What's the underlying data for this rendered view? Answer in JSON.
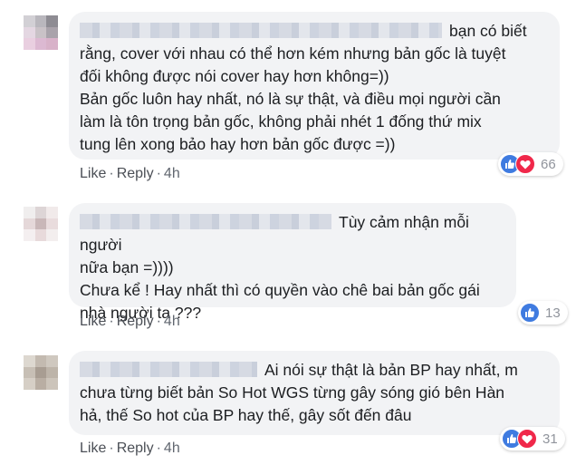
{
  "comments": [
    {
      "text_lines": [
        "bạn có biết",
        "rằng, cover với nhau có thể hơn kém nhưng bản gốc là tuyệt",
        "đối không được nói cover hay hơn không=))",
        "Bản gốc luôn hay nhất, nó là sự thật, và điều mọi người cần",
        "làm là tôn trọng bản gốc, không phải nhét 1 đống thứ mix",
        "tung lên xong bảo hay hơn bản gốc được =))"
      ],
      "like_label": "Like",
      "reply_label": "Reply",
      "time": "4h",
      "reaction_count": "66",
      "reactions": [
        "like-icon",
        "love-icon"
      ]
    },
    {
      "text_lines": [
        "Tùy cảm nhận mỗi người",
        "nữa bạn =))))",
        "Chưa kể ! Hay nhất thì có quyền vào chê bai bản gốc gái",
        "nhà người ta ???"
      ],
      "like_label": "Like",
      "reply_label": "Reply",
      "time": "4h",
      "reaction_count": "13",
      "reactions": [
        "like-icon"
      ]
    },
    {
      "text_lines": [
        "Ai nói sự thật là bản BP hay nhất, m",
        "chưa từng biết bản So Hot WGS từng gây sóng gió bên Hàn",
        "hả, thế So hot của BP hay thế, gây sốt đến đâu"
      ],
      "like_label": "Like",
      "reply_label": "Reply",
      "time": "4h",
      "reaction_count": "31",
      "reactions": [
        "like-icon",
        "love-icon"
      ]
    }
  ],
  "colors": {
    "like_blue": "#3f7be0",
    "love_red": "#f0284a",
    "bubble_bg": "#f2f3f5"
  }
}
